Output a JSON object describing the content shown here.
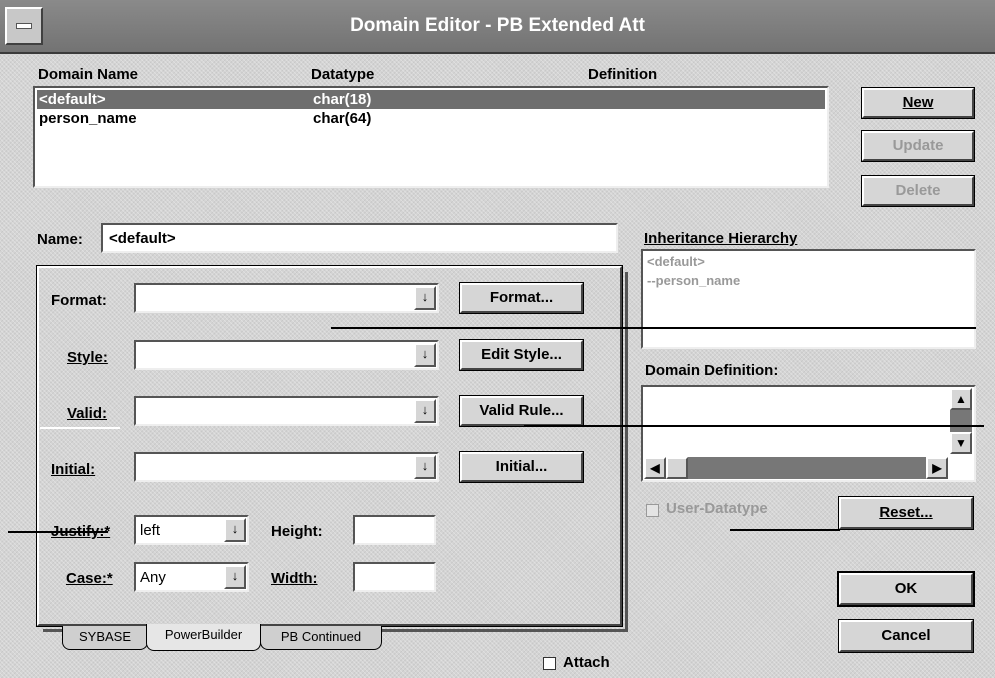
{
  "window": {
    "title": "Domain Editor - PB Extended Att"
  },
  "domain_list": {
    "headers": {
      "name": "Domain Name",
      "datatype": "Datatype",
      "definition": "Definition"
    },
    "rows": [
      {
        "name": "<default>",
        "datatype": "char(18)"
      },
      {
        "name": "person_name",
        "datatype": "char(64)"
      }
    ]
  },
  "buttons": {
    "new": "New",
    "update": "Update",
    "delete": "Delete",
    "reset": "Reset...",
    "ok": "OK",
    "cancel": "Cancel"
  },
  "name_field": {
    "label": "Name:",
    "value": "<default>"
  },
  "inheritance": {
    "label": "Inheritance Hierarchy",
    "items": [
      "<default>",
      "--person_name"
    ]
  },
  "domain_definition": {
    "label": "Domain Definition:"
  },
  "user_datatype": {
    "label": "User-Datatype"
  },
  "attach": {
    "label": "Attach"
  },
  "powerbuilder": {
    "format_label": "Format:",
    "style_label": "Style:",
    "valid_label": "Valid:",
    "initial_label": "Initial:",
    "format_button": "Format...",
    "edit_style_button": "Edit Style...",
    "valid_rule_button": "Valid Rule...",
    "initial_button": "Initial...",
    "justify_label": "Justify:*",
    "justify_value": "left",
    "case_label": "Case:*",
    "case_value": "Any",
    "height_label": "Height:",
    "width_label": "Width:",
    "dropdown_arrow": "↓"
  },
  "tabs": [
    "SYBASE",
    "PowerBuilder",
    "PB Continued"
  ],
  "scroll_glyphs": {
    "up": "▲",
    "down": "▼",
    "left": "◀",
    "right": "▶"
  }
}
